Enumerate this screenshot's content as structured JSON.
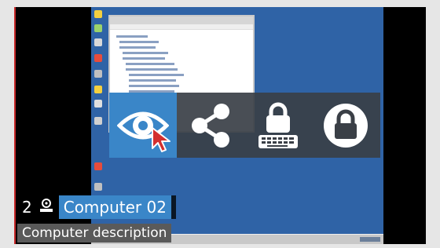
{
  "computer": {
    "number": "2",
    "name": "Computer 02",
    "description": "Computer description"
  },
  "actions": [
    {
      "id": "view",
      "icon": "eye-icon",
      "active": true
    },
    {
      "id": "share",
      "icon": "share-icon",
      "active": false
    },
    {
      "id": "lock-input",
      "icon": "lock-keyboard-icon",
      "active": false
    },
    {
      "id": "lock-screen",
      "icon": "lock-icon",
      "active": false
    }
  ],
  "colors": {
    "accent": "#3a86c8",
    "desktop": "#2f63a6",
    "action_bar": "#3a3f46",
    "alert_border": "#c62828"
  }
}
